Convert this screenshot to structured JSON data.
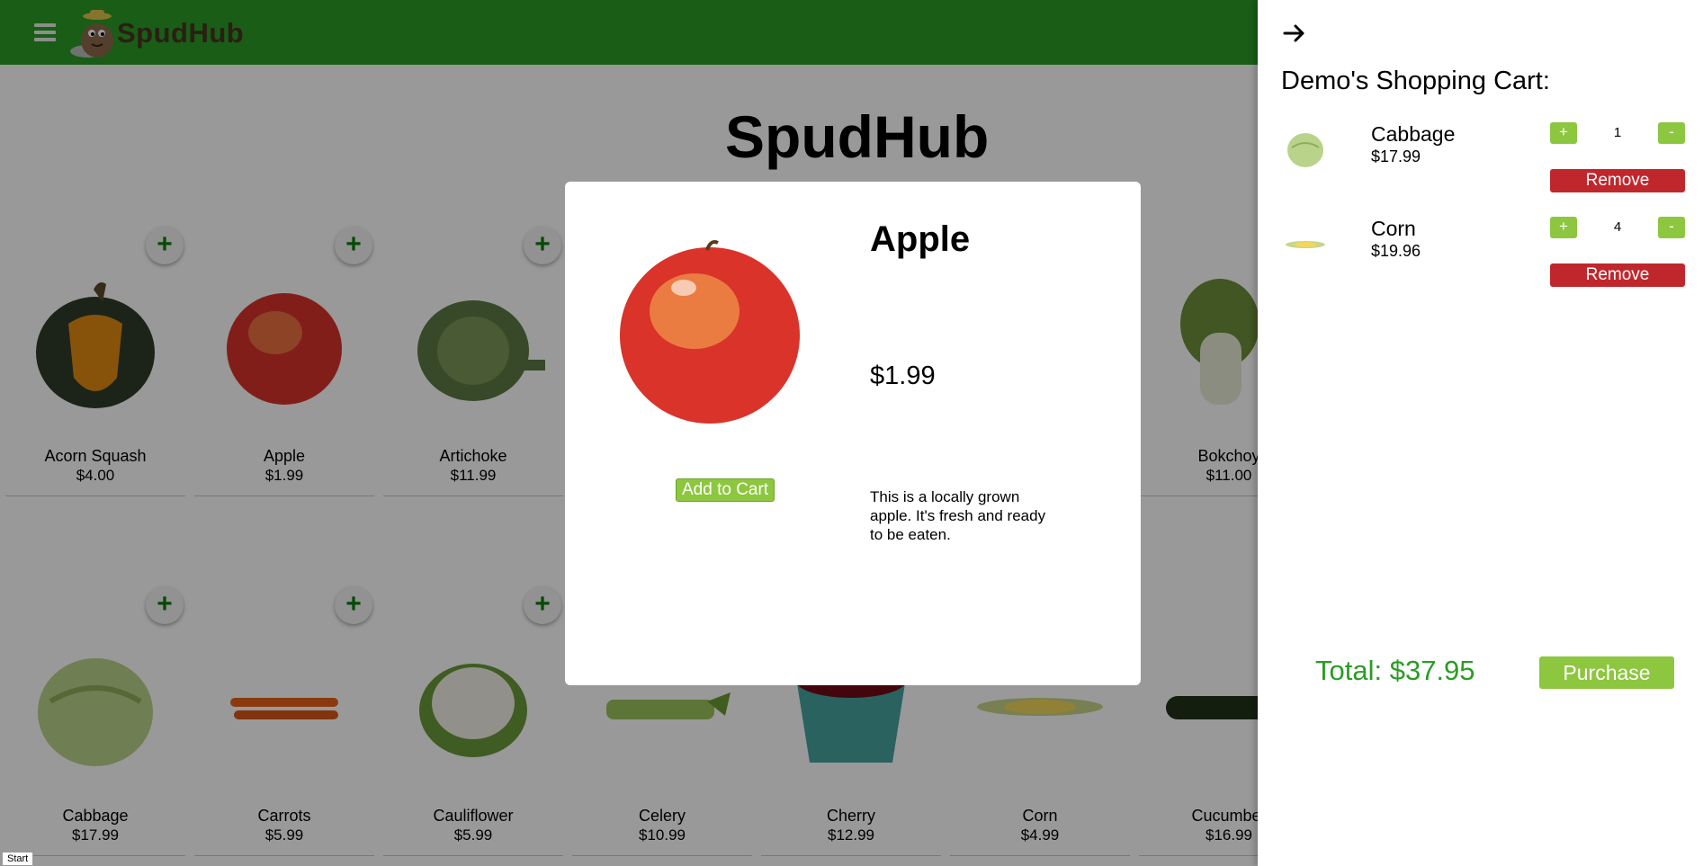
{
  "header": {
    "logo_text": "SpudHub",
    "menu_icon": "hamburger-icon",
    "brand_color": "#2a9c25"
  },
  "main": {
    "title": "SpudHub"
  },
  "products": [
    {
      "name": "Acorn Squash",
      "price": "$4.00"
    },
    {
      "name": "Apple",
      "price": "$1.99"
    },
    {
      "name": "Artichoke",
      "price": "$11.99"
    },
    {
      "name": "Bokchoy",
      "price": "$11.00"
    },
    {
      "name": "Cabbage",
      "price": "$17.99"
    },
    {
      "name": "Carrots",
      "price": "$5.99"
    },
    {
      "name": "Cauliflower",
      "price": "$5.99"
    },
    {
      "name": "Celery",
      "price": "$10.99"
    },
    {
      "name": "Cherry",
      "price": "$12.99"
    },
    {
      "name": "Corn",
      "price": "$4.99"
    },
    {
      "name": "Cucumber",
      "price": "$16.99"
    }
  ],
  "add_icon_label": "+",
  "modal": {
    "title": "Apple",
    "price": "$1.99",
    "add_label": "Add to Cart",
    "description": "This is a locally grown apple. It's fresh and ready to be eaten."
  },
  "cart": {
    "close_icon": "arrow-right-icon",
    "title": "Demo's Shopping Cart:",
    "items": [
      {
        "name": "Cabbage",
        "price": "$17.99",
        "qty": "1",
        "plus": "+",
        "minus": "-",
        "remove": "Remove"
      },
      {
        "name": "Corn",
        "price": "$19.96",
        "qty": "4",
        "plus": "+",
        "minus": "-",
        "remove": "Remove"
      }
    ],
    "total": "Total: $37.95",
    "purchase_label": "Purchase"
  },
  "start_label": "Start",
  "colors": {
    "accent_green": "#8dc63f",
    "remove_red": "#c0272d",
    "total_green": "#2a9c25"
  }
}
